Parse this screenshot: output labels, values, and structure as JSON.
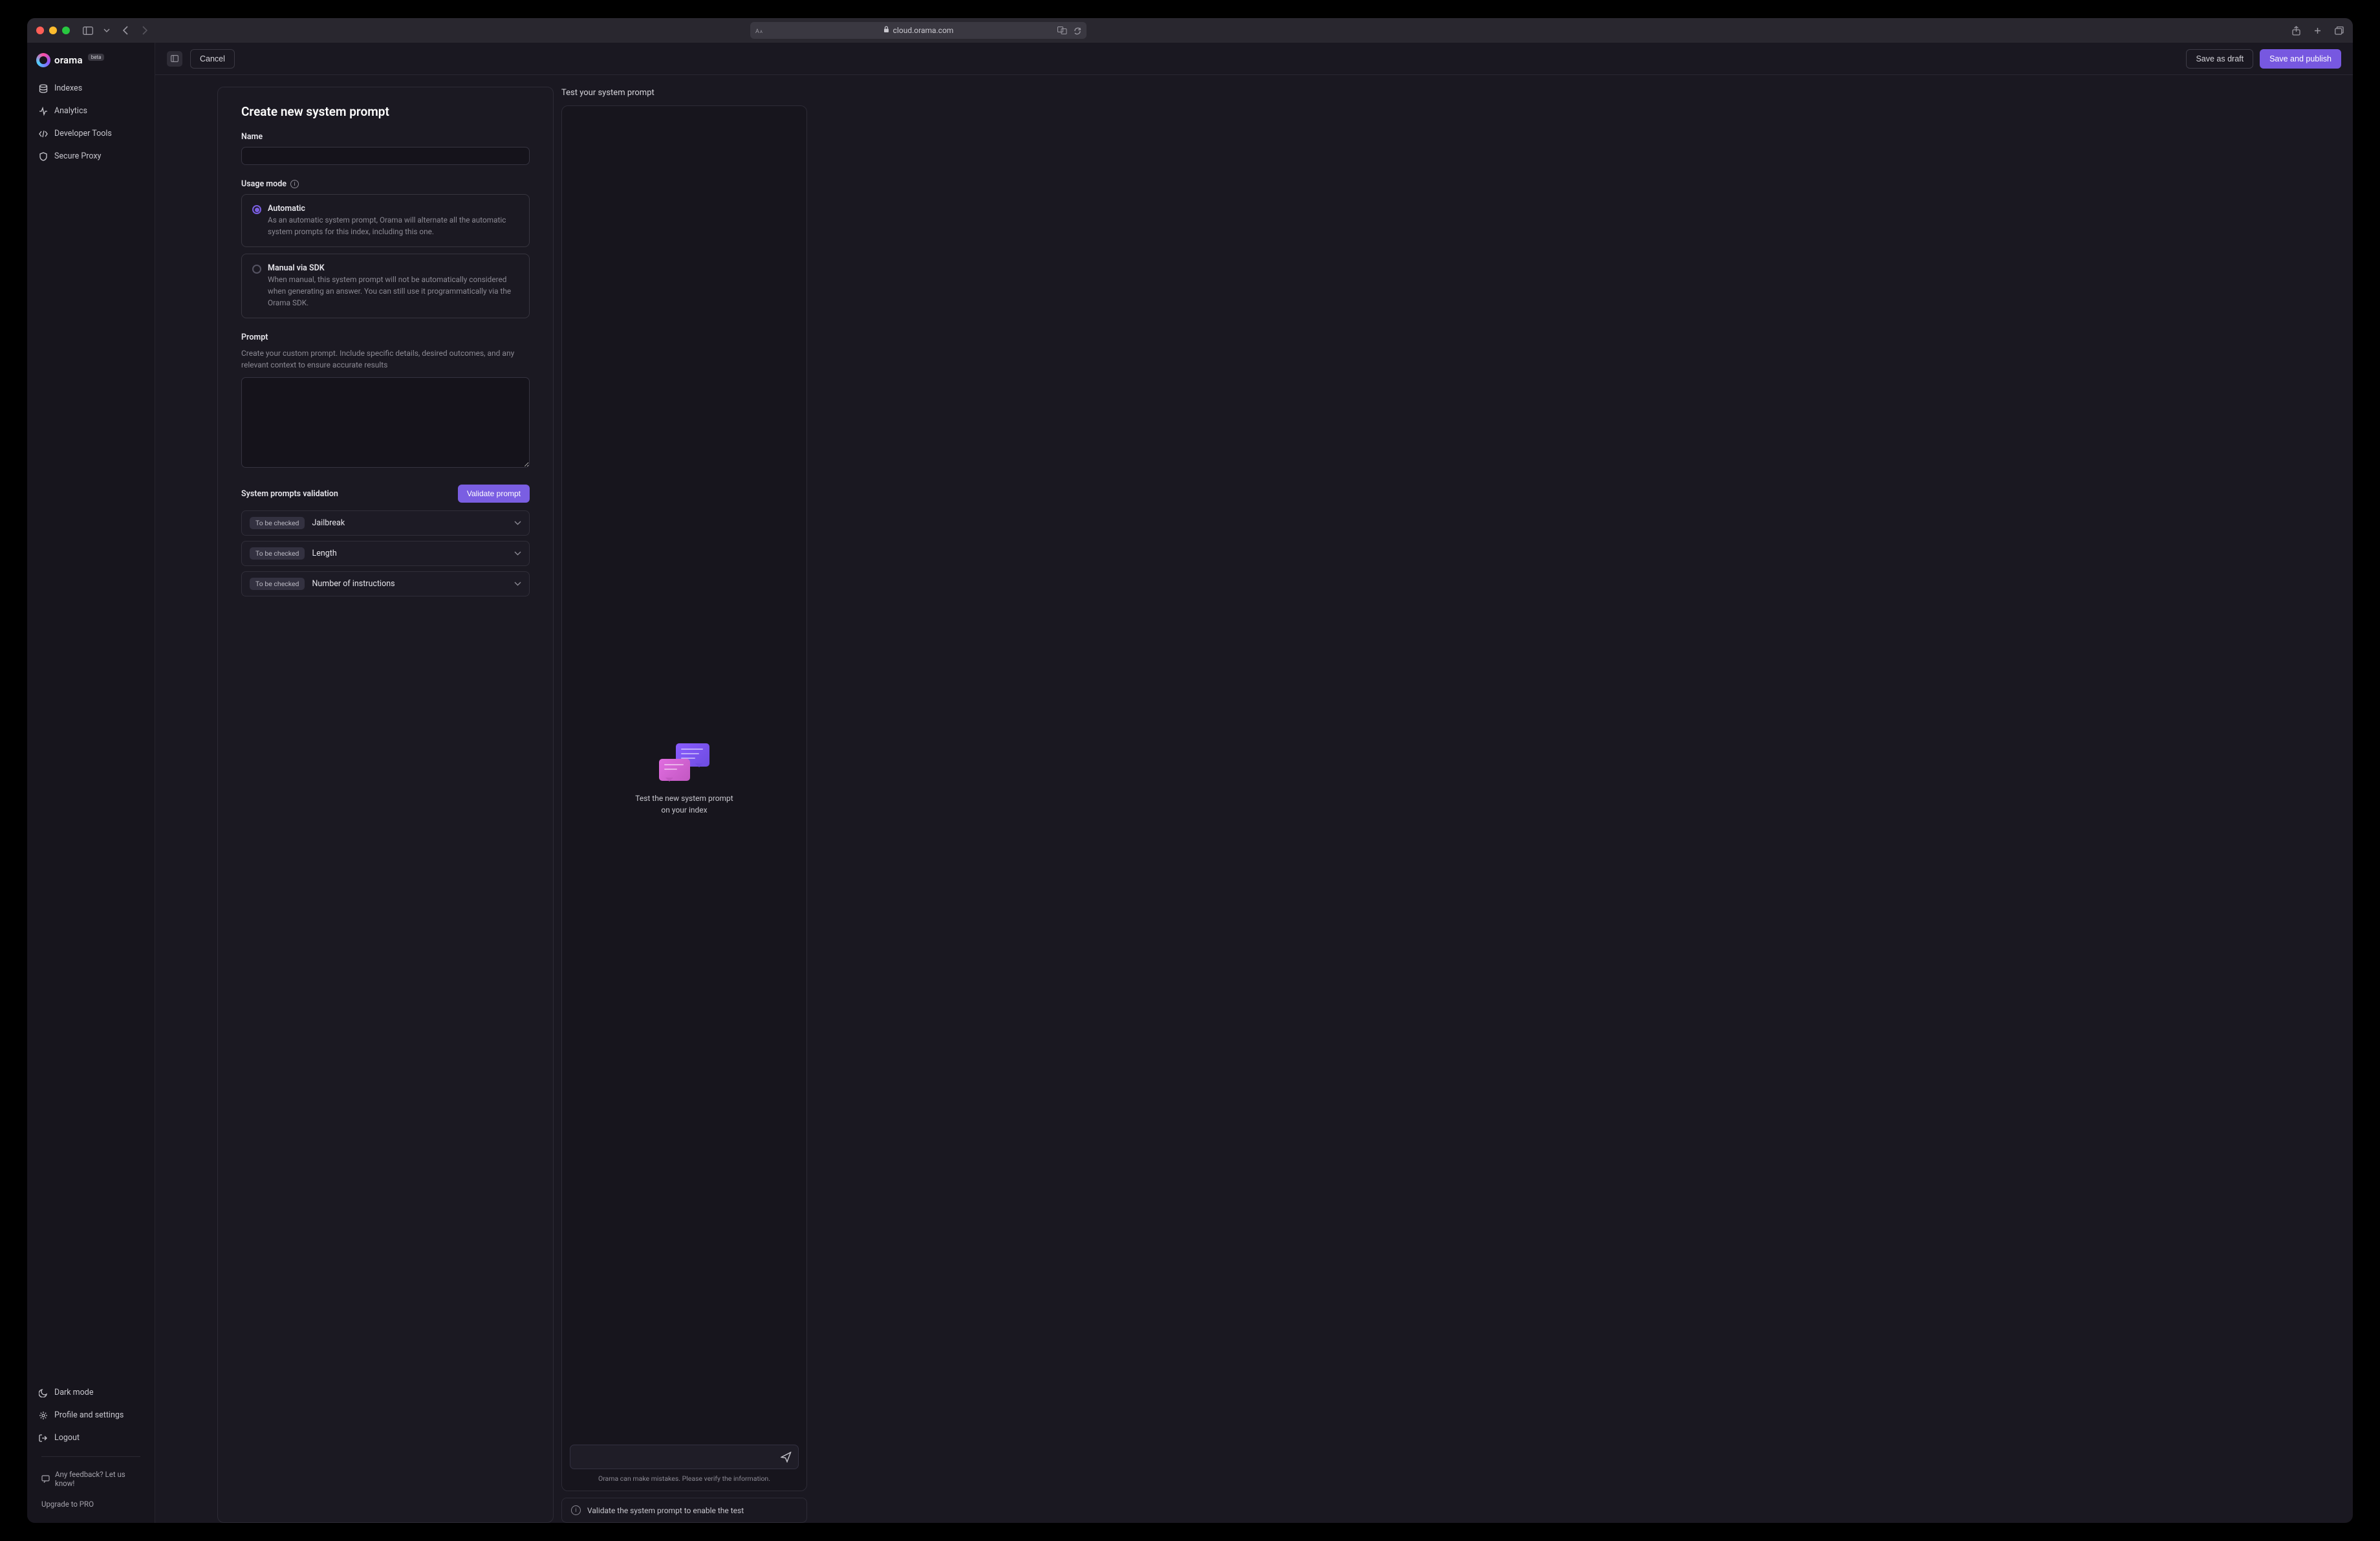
{
  "browser": {
    "url": "cloud.orama.com"
  },
  "brand": {
    "name": "orama",
    "badge": "beta"
  },
  "sidebar": {
    "nav": [
      {
        "label": "Indexes"
      },
      {
        "label": "Analytics"
      },
      {
        "label": "Developer Tools"
      },
      {
        "label": "Secure Proxy"
      }
    ],
    "bottom": [
      {
        "label": "Dark mode"
      },
      {
        "label": "Profile and settings"
      },
      {
        "label": "Logout"
      }
    ],
    "feedback": "Any feedback? Let us know!",
    "upgrade": "Upgrade to PRO"
  },
  "topbar": {
    "cancel": "Cancel",
    "save_draft": "Save as draft",
    "save_publish": "Save and publish"
  },
  "form": {
    "title": "Create new system prompt",
    "name_label": "Name",
    "name_value": "",
    "usage_label": "Usage mode",
    "usage_options": [
      {
        "title": "Automatic",
        "desc": "As an automatic system prompt, Orama will alternate all the automatic system prompts for this index, including this one.",
        "checked": true
      },
      {
        "title": "Manual via SDK",
        "desc": "When manual, this system prompt will not be automatically considered when generating an answer. You can still use it programmatically via the Orama SDK.",
        "checked": false
      }
    ],
    "prompt_label": "Prompt",
    "prompt_help": "Create your custom prompt. Include specific details, desired outcomes, and any relevant context to ensure accurate results",
    "prompt_value": "",
    "validation_title": "System prompts validation",
    "validate_btn": "Validate prompt",
    "validations": [
      {
        "status": "To be checked",
        "name": "Jailbreak"
      },
      {
        "status": "To be checked",
        "name": "Length"
      },
      {
        "status": "To be checked",
        "name": "Number of instructions"
      }
    ]
  },
  "test": {
    "title": "Test your system prompt",
    "empty_line1": "Test the new system prompt",
    "empty_line2": "on your index",
    "input_value": "",
    "disclaimer": "Orama can make mistakes. Please verify the information.",
    "notice": "Validate the system prompt to enable the test"
  }
}
